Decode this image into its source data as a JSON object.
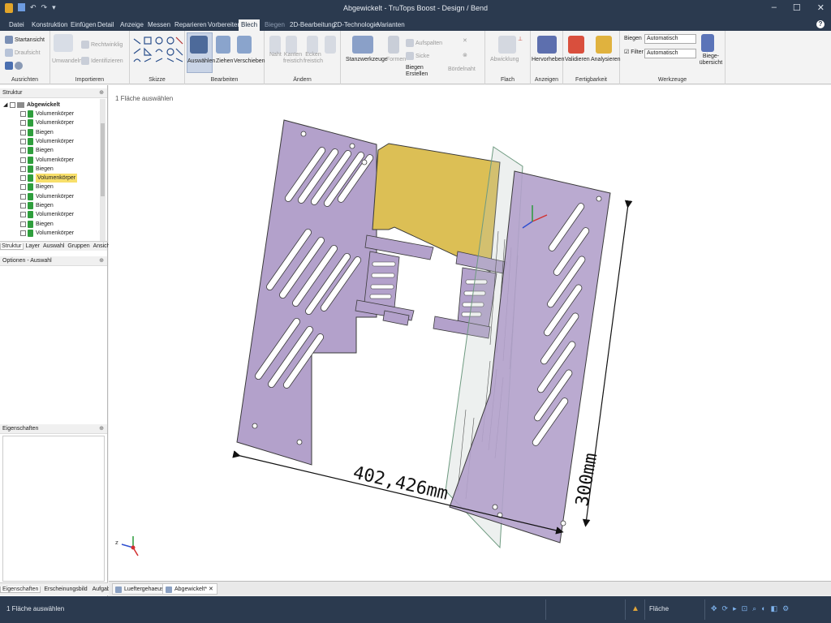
{
  "window": {
    "title": "Abgewickelt - TruTops Boost - Design / Bend",
    "quick_icons": [
      "↶",
      "↷",
      "▾"
    ],
    "controls": [
      "–",
      "☐",
      "✕"
    ]
  },
  "menu": {
    "tabs": [
      "Datei",
      "Konstruktion",
      "Einfügen",
      "Detail",
      "Anzeige",
      "Messen",
      "Reparieren",
      "Vorbereiten",
      "Blech",
      "Biegen",
      "2D-Bearbeitung",
      "2D-Technologie",
      "Varianten"
    ],
    "active": "Blech",
    "help": "?"
  },
  "ribbon": {
    "groups": [
      "Ausrichten",
      "Importieren",
      "Skizze",
      "Bearbeiten",
      "Ändern",
      "",
      "Flach",
      "Anzeigen",
      "Fertigbarkeit",
      "Werkzeuge"
    ],
    "ausrichten": [
      "Startansicht",
      "Draufsicht"
    ],
    "importieren": [
      "Umwandeln",
      "Rechtwinklig",
      "Identifizieren"
    ],
    "bearbeiten": [
      "Auswählen",
      "Ziehen",
      "Verschieben"
    ],
    "aendern": [
      "Naht",
      "Kanten freistich",
      "Ecken freistich"
    ],
    "werkzeugbar": [
      "Stanzwerkzeuge",
      "Formen",
      "Aufspalten",
      "Sicke",
      "Biegen Erstellen",
      "Bördelnaht"
    ],
    "flach": "Abwicklung",
    "anzeigen": "Hervorheben",
    "fertig": [
      "Validieren",
      "Analysieren"
    ],
    "werkzeuge": {
      "biegen_label": "Biegen",
      "biegen_value": "Automatisch",
      "filter_label": "Filter",
      "filter_value": "Automatisch",
      "uebersicht": "Biege-übersicht"
    }
  },
  "structure": {
    "title": "Struktur",
    "root": "Abgewickelt",
    "items": [
      "Volumenkörper",
      "Volumenkörper",
      "Biegen",
      "Volumenkörper",
      "Biegen",
      "Volumenkörper",
      "Biegen",
      "Volumenkörper",
      "Biegen",
      "Volumenkörper",
      "Biegen",
      "Volumenkörper",
      "Biegen",
      "Volumenkörper"
    ],
    "selected_index": 7,
    "tabs": [
      "Struktur",
      "Layer",
      "Auswahl",
      "Gruppen",
      "Ansichten"
    ]
  },
  "options": {
    "title": "Optionen - Auswahl"
  },
  "properties": {
    "title": "Eigenschaften"
  },
  "bottom_tabs": [
    "Eigenschaften",
    "Erscheinungsbild",
    "Aufgaben"
  ],
  "viewport": {
    "hint": "1 Fläche auswählen",
    "dim_width": "402,426mm",
    "dim_height": "300mm",
    "colors": {
      "sheet": "#b3a1cb",
      "highlight": "#dcbf55",
      "edge": "#3a3a3a"
    }
  },
  "doc_tabs": [
    "Lueftergehaeuse*",
    "Abgewickelt*"
  ],
  "status": {
    "message": "1 Fläche auswählen",
    "mode": "Fläche"
  }
}
